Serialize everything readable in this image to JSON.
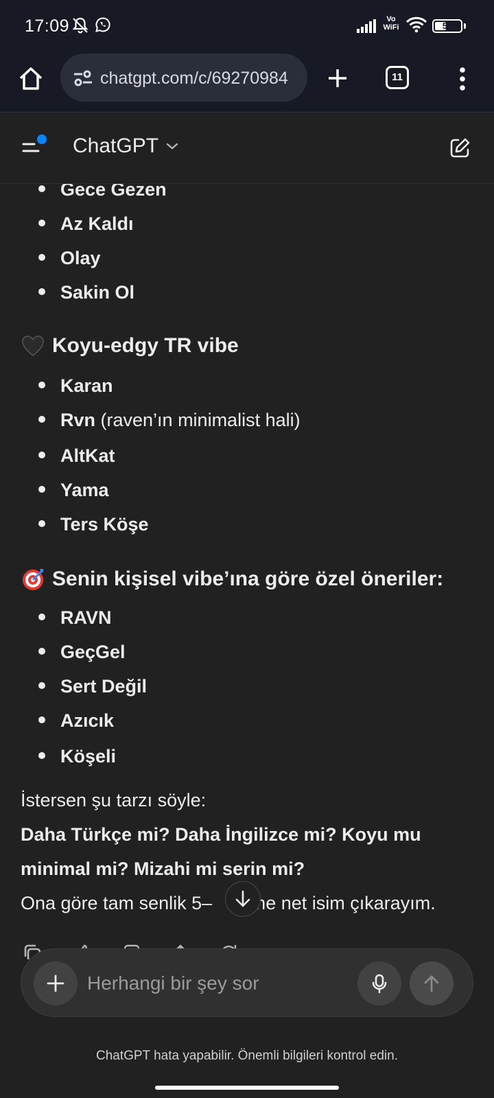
{
  "status_bar": {
    "time": "17:09",
    "vowifi_top": "Vo",
    "vowifi_bottom": "WiFi",
    "battery": "51",
    "battery_level": 0.51
  },
  "browser": {
    "url": "chatgpt.com/c/69270984",
    "tab_count": "11"
  },
  "header": {
    "title": "ChatGPT"
  },
  "chat": {
    "list1": [
      "Gece Gezen",
      "Az Kaldı",
      "Olay",
      "Sakin Ol"
    ],
    "section2_title": "Koyu-edgy TR vibe",
    "list2": [
      {
        "bold": "Karan",
        "rest": ""
      },
      {
        "bold": "Rvn",
        "rest": " (raven’ın minimalist hali)"
      },
      {
        "bold": "AltKat",
        "rest": ""
      },
      {
        "bold": "Yama",
        "rest": ""
      },
      {
        "bold": "Ters Köşe",
        "rest": ""
      }
    ],
    "section3_title": "Senin kişisel vibe’ına göre özel öneriler:",
    "list3": [
      "RAVN",
      "GeçGel",
      "Sert Değil",
      "Azıcık",
      "Köşeli"
    ],
    "para1": "İstersen şu tarzı söyle:",
    "para2": "Daha Türkçe mi? Daha İngilizce mi? Koyu mu",
    "para3": "minimal mi? Mizahi mi serin mi?",
    "para4_start": "Ona göre tam senlik 5–",
    "para4_end": "ane net isim çıkarayım."
  },
  "composer": {
    "placeholder": "Herhangi bir şey sor"
  },
  "footer": {
    "disclaimer": "ChatGPT hata yapabilir. Önemli bilgileri kontrol edin."
  },
  "colors": {
    "background": "#212121",
    "statusbar": "#171a24",
    "accent_dot": "#0a84ff"
  },
  "icons": [
    "bell-off-icon",
    "whatsapp-icon",
    "signal-icon",
    "wifi-icon",
    "battery-icon",
    "home-icon",
    "tune-icon",
    "plus-icon",
    "tabs-icon",
    "more-vert-icon",
    "sidebar-icon",
    "chevron-down-icon",
    "edit-icon",
    "black-heart-emoji",
    "target-emoji",
    "copy-icon",
    "thumbs-up-icon",
    "thumbs-down-icon",
    "share-icon",
    "regenerate-icon",
    "arrow-down-icon",
    "mic-icon",
    "send-icon"
  ]
}
